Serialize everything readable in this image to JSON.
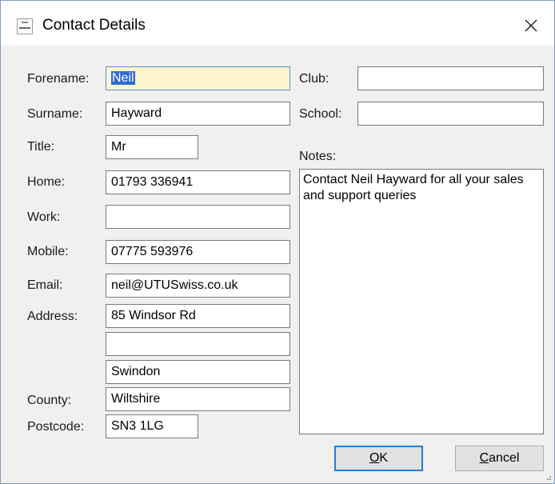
{
  "window": {
    "title": "Contact Details",
    "icon": "utu-swiss-app-icon",
    "close_icon": "close-icon"
  },
  "fields": {
    "forename": {
      "label": "Forename:",
      "value": "Neil"
    },
    "surname": {
      "label": "Surname:",
      "value": "Hayward"
    },
    "title": {
      "label": "Title:",
      "value": "Mr"
    },
    "home": {
      "label": "Home:",
      "value": "01793 336941"
    },
    "work": {
      "label": "Work:",
      "value": ""
    },
    "mobile": {
      "label": "Mobile:",
      "value": "07775 593976"
    },
    "email": {
      "label": "Email:",
      "value": "neil@UTUSwiss.co.uk"
    },
    "address": {
      "label": "Address:",
      "line1": "85 Windsor Rd",
      "line2": "",
      "line3": "Swindon"
    },
    "county": {
      "label": "County:",
      "value": "Wiltshire"
    },
    "postcode": {
      "label": "Postcode:",
      "value": "SN3 1LG"
    },
    "club": {
      "label": "Club:",
      "value": ""
    },
    "school": {
      "label": "School:",
      "value": ""
    },
    "notes": {
      "label": "Notes:",
      "value": "Contact Neil Hayward for all your sales and support queries"
    }
  },
  "buttons": {
    "ok": "OK",
    "cancel": "Cancel"
  },
  "colors": {
    "focus_background": "#fdf5d0",
    "selection": "#2f6cd6",
    "default_button_border": "#2a7ad6",
    "window_border": "#7a9cc6"
  }
}
